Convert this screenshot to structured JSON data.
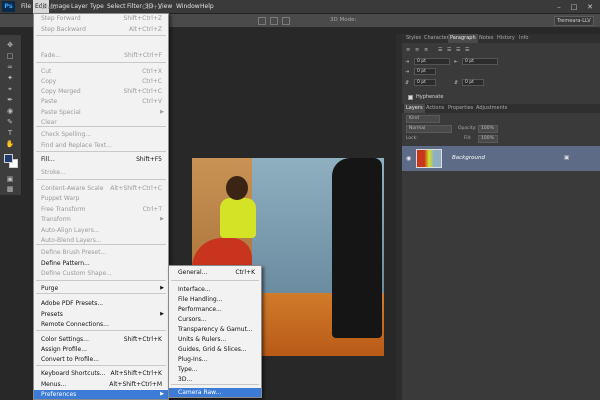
{
  "app": {
    "logo": "Ps"
  },
  "menubar": {
    "items": [
      "File",
      "Edit",
      "Image",
      "Layer",
      "Type",
      "Select",
      "Filter",
      "3D",
      "View",
      "Window",
      "Help"
    ],
    "active": "Edit"
  },
  "optionsbar": {
    "mode_3d": "3D Mode:",
    "workspace": "Tremeara-LLV"
  },
  "window_controls": [
    "minimize-icon",
    "maximize-icon",
    "close-icon"
  ],
  "edit_menu": {
    "items": [
      {
        "label": "Undo",
        "shortcut": "Ctrl+Z",
        "disabled": true
      },
      {
        "label": "Step Forward",
        "shortcut": "Shift+Ctrl+Z",
        "disabled": true
      },
      {
        "label": "Step Backward",
        "shortcut": "Alt+Ctrl+Z",
        "disabled": true
      },
      {
        "label": "Fade...",
        "shortcut": "Shift+Ctrl+F",
        "disabled": true
      },
      {
        "label": "Cut",
        "shortcut": "Ctrl+X",
        "disabled": true
      },
      {
        "label": "Copy",
        "shortcut": "Ctrl+C",
        "disabled": true
      },
      {
        "label": "Copy Merged",
        "shortcut": "Shift+Ctrl+C",
        "disabled": true
      },
      {
        "label": "Paste",
        "shortcut": "Ctrl+V",
        "disabled": true
      },
      {
        "label": "Paste Special",
        "shortcut": "",
        "disabled": true,
        "submenu": true
      },
      {
        "label": "Clear",
        "shortcut": "",
        "disabled": true
      },
      {
        "label": "Check Spelling...",
        "shortcut": "",
        "disabled": true
      },
      {
        "label": "Find and Replace Text...",
        "shortcut": "",
        "disabled": true
      },
      {
        "label": "Fill...",
        "shortcut": "Shift+F5",
        "disabled": false
      },
      {
        "label": "Stroke...",
        "shortcut": "",
        "disabled": true
      },
      {
        "label": "Content-Aware Scale",
        "shortcut": "Alt+Shift+Ctrl+C",
        "disabled": true
      },
      {
        "label": "Puppet Warp",
        "shortcut": "",
        "disabled": true
      },
      {
        "label": "Free Transform",
        "shortcut": "Ctrl+T",
        "disabled": true
      },
      {
        "label": "Transform",
        "shortcut": "",
        "disabled": true,
        "submenu": true
      },
      {
        "label": "Auto-Align Layers...",
        "shortcut": "",
        "disabled": true
      },
      {
        "label": "Auto-Blend Layers...",
        "shortcut": "",
        "disabled": true
      },
      {
        "label": "Define Brush Preset...",
        "shortcut": "",
        "disabled": true
      },
      {
        "label": "Define Pattern...",
        "shortcut": "",
        "disabled": false
      },
      {
        "label": "Define Custom Shape...",
        "shortcut": "",
        "disabled": true
      },
      {
        "label": "Purge",
        "shortcut": "",
        "disabled": false,
        "submenu": true
      },
      {
        "label": "Adobe PDF Presets...",
        "shortcut": "",
        "disabled": false
      },
      {
        "label": "Presets",
        "shortcut": "",
        "disabled": false,
        "submenu": true
      },
      {
        "label": "Remote Connections...",
        "shortcut": "",
        "disabled": false
      },
      {
        "label": "Color Settings...",
        "shortcut": "Shift+Ctrl+K",
        "disabled": false
      },
      {
        "label": "Assign Profile...",
        "shortcut": "",
        "disabled": false
      },
      {
        "label": "Convert to Profile...",
        "shortcut": "",
        "disabled": false
      },
      {
        "label": "Keyboard Shortcuts...",
        "shortcut": "Alt+Shift+Ctrl+K",
        "disabled": false
      },
      {
        "label": "Menus...",
        "shortcut": "Alt+Shift+Ctrl+M",
        "disabled": false
      },
      {
        "label": "Preferences",
        "shortcut": "",
        "disabled": false,
        "submenu": true,
        "highlight": true
      }
    ]
  },
  "preferences_menu": {
    "items": [
      {
        "label": "General...",
        "shortcut": "Ctrl+K"
      },
      {
        "label": "Interface...",
        "shortcut": ""
      },
      {
        "label": "File Handling...",
        "shortcut": ""
      },
      {
        "label": "Performance...",
        "shortcut": ""
      },
      {
        "label": "Cursors...",
        "shortcut": ""
      },
      {
        "label": "Transparency & Gamut...",
        "shortcut": ""
      },
      {
        "label": "Units & Rulers...",
        "shortcut": ""
      },
      {
        "label": "Guides, Grid & Slices...",
        "shortcut": ""
      },
      {
        "label": "Plug-Ins...",
        "shortcut": ""
      },
      {
        "label": "Type...",
        "shortcut": ""
      },
      {
        "label": "3D...",
        "shortcut": ""
      },
      {
        "label": "Camera Raw...",
        "shortcut": "",
        "highlight": true
      }
    ]
  },
  "top_panel": {
    "tabs": [
      "Styles",
      "Character",
      "Paragraph",
      "Notes",
      "History",
      "Info"
    ],
    "active_tab": "Paragraph",
    "fields": {
      "indent_left": "0 pt",
      "indent_right": "0 pt",
      "indent_first": "0 pt",
      "space_before": "0 pt",
      "space_after": "0 pt"
    },
    "hyphenate_label": "Hyphenate"
  },
  "layers_panel": {
    "tabs": [
      "Layers",
      "Actions",
      "Properties",
      "Adjustments"
    ],
    "active_tab": "Layers",
    "filter_kind": "Kind",
    "blend_mode": "Normal",
    "opacity_label": "Opacity:",
    "opacity_value": "100%",
    "lock_label": "Lock:",
    "fill_label": "Fill:",
    "fill_value": "100%",
    "layers": [
      {
        "name": "Background",
        "locked": true,
        "visible": true
      }
    ]
  }
}
